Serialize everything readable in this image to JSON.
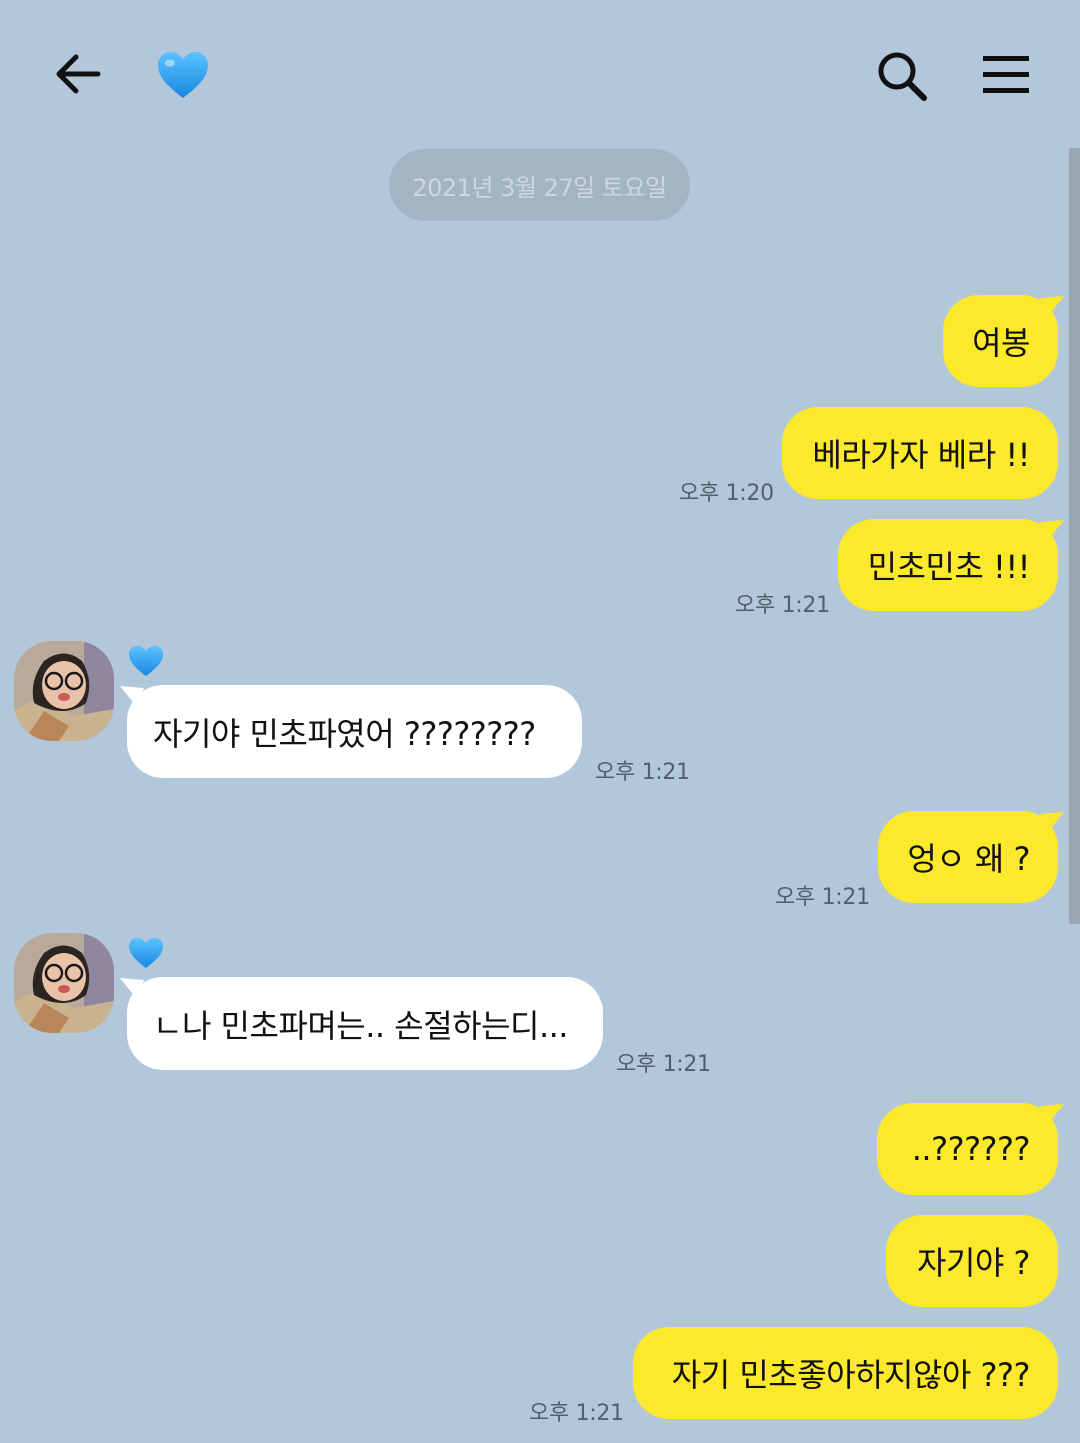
{
  "header": {
    "back_icon": "arrow-left-icon",
    "title_icon": "blue-heart-icon",
    "search_icon": "search-icon",
    "menu_icon": "hamburger-menu-icon"
  },
  "chat": {
    "date_divider": "2021년 3월 27일 토요일",
    "sender": {
      "name_icon": "blue-heart-icon",
      "avatar": "profile-photo"
    },
    "messages": [
      {
        "from": "me",
        "text": "여봉",
        "time": ""
      },
      {
        "from": "me",
        "text": "베라가자 베라 !!",
        "time": "오후 1:20"
      },
      {
        "from": "me",
        "text": "민초민초 !!!",
        "time": "오후 1:21"
      },
      {
        "from": "them",
        "text": "자기야 민초파였어 ????????",
        "time": "오후 1:21"
      },
      {
        "from": "me",
        "text": "엉ㅇ 왜 ?",
        "time": "오후 1:21"
      },
      {
        "from": "them",
        "text": "ㄴ나 민초파며는.. 손절하는디...",
        "time": "오후 1:21"
      },
      {
        "from": "me",
        "text": "..??????",
        "time": ""
      },
      {
        "from": "me",
        "text": "자기야 ?",
        "time": ""
      },
      {
        "from": "me",
        "text": "자기 민초좋아하지않아 ???",
        "time": "오후 1:21"
      }
    ]
  },
  "colors": {
    "background": "#b2c7da",
    "my_bubble": "#fde92b",
    "their_bubble": "#ffffff",
    "heart": "#2a9df4"
  }
}
